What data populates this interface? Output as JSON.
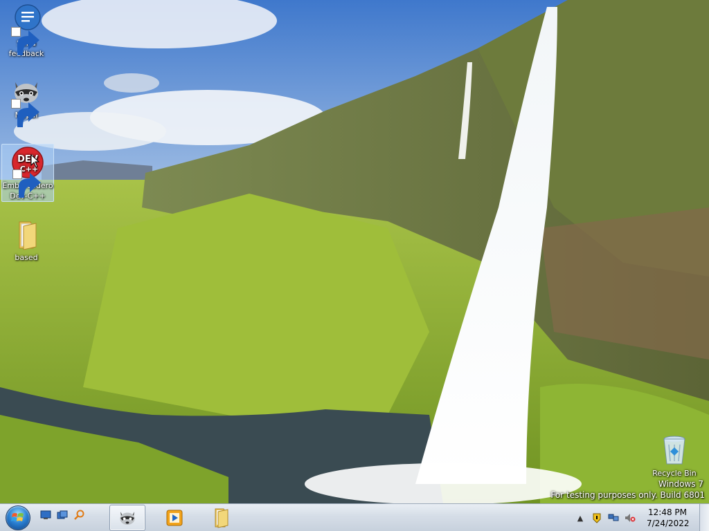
{
  "desktop": {
    "icons": [
      {
        "label": "Send\nfeedback",
        "icon": "feedback-speech-icon",
        "shortcut": true,
        "selected": false
      },
      {
        "label": "Mypal",
        "icon": "raccoon-icon",
        "shortcut": true,
        "selected": false
      },
      {
        "label": "Embarcadero\nDev-C++",
        "icon": "devcpp-icon",
        "shortcut": true,
        "selected": true
      },
      {
        "label": "based",
        "icon": "folder-icon",
        "shortcut": false,
        "selected": false
      },
      {
        "label": "Recycle Bin",
        "icon": "recycle-bin-icon",
        "shortcut": false,
        "selected": false
      }
    ],
    "devcpp_badge": {
      "top": "DEV",
      "bottom": "C++"
    }
  },
  "watermark": {
    "line1": "Windows 7",
    "line2": "For testing purposes only. Build 6801"
  },
  "taskbar": {
    "start": "start-orb-icon",
    "quick_launch": [
      "show-desktop-icon",
      "switch-windows-icon",
      "search-icon"
    ],
    "pinned": [
      "mypal-raccoon-icon",
      "media-player-icon",
      "explorer-folder-icon"
    ],
    "active_index": 0
  },
  "tray": {
    "icons": [
      "show-hidden-icons",
      "action-center-icon",
      "network-icon",
      "volume-muted-icon"
    ],
    "time": "12:48 PM",
    "date": "7/24/2022"
  },
  "colors": {
    "sky": "#4f86d1",
    "grass": "#8fb135",
    "selection": "#add0f5",
    "taskbar": "#d5dde7"
  }
}
